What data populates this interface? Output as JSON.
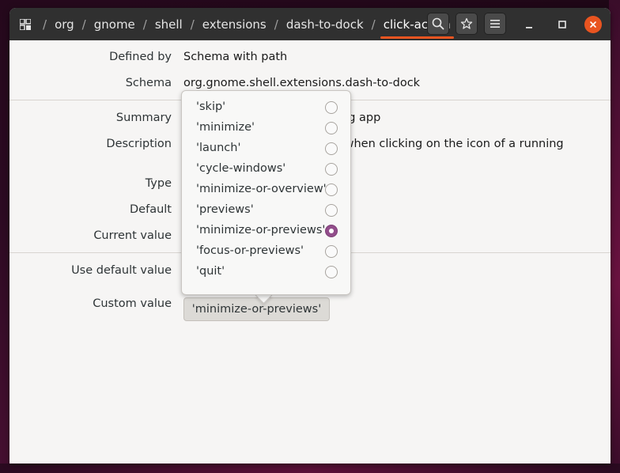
{
  "breadcrumbs": [
    "org",
    "gnome",
    "shell",
    "extensions",
    "dash-to-dock",
    "click-action"
  ],
  "header_icons": {
    "apps": "grid-icon",
    "search": "search-icon",
    "bookmark": "star-icon",
    "menu": "hamburger-menu-icon",
    "minimize": "minimize-icon",
    "maximize": "maximize-icon",
    "close": "close-icon"
  },
  "fields": {
    "defined_by": {
      "label": "Defined by",
      "value": "Schema with path"
    },
    "schema": {
      "label": "Schema",
      "value": "org.gnome.shell.extensions.dash-to-dock"
    },
    "summary": {
      "label": "Summary",
      "value": "ing app"
    },
    "description": {
      "label": "Description",
      "value": "l when clicking on the icon of a running"
    },
    "type": {
      "label": "Type"
    },
    "default": {
      "label": "Default"
    },
    "current_value": {
      "label": "Current value"
    },
    "use_default_value": {
      "label": "Use default value"
    },
    "custom_value": {
      "label": "Custom value",
      "value": "'minimize-or-previews'"
    }
  },
  "options": [
    {
      "label": "'skip'",
      "checked": false
    },
    {
      "label": "'minimize'",
      "checked": false
    },
    {
      "label": "'launch'",
      "checked": false
    },
    {
      "label": "'cycle-windows'",
      "checked": false
    },
    {
      "label": "'minimize-or-overview'",
      "checked": false
    },
    {
      "label": "'previews'",
      "checked": false
    },
    {
      "label": "'minimize-or-previews'",
      "checked": true
    },
    {
      "label": "'focus-or-previews'",
      "checked": false
    },
    {
      "label": "'quit'",
      "checked": false
    }
  ],
  "colors": {
    "accent": "#e95420",
    "radio_selected": "#924d8b",
    "headerbar": "#303030"
  }
}
